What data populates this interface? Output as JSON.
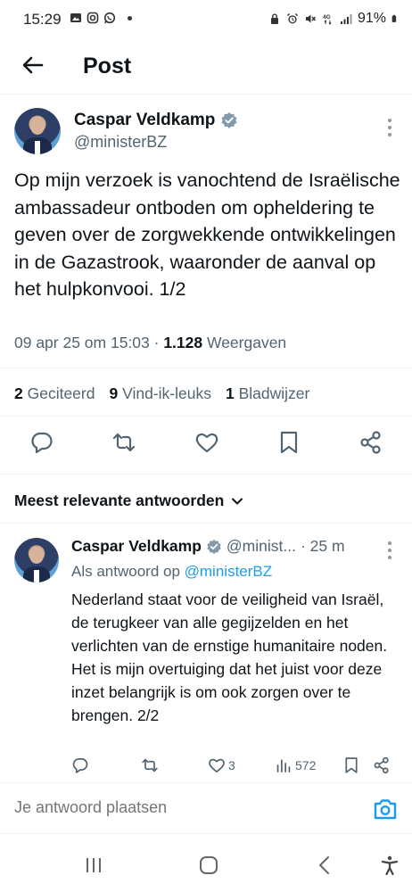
{
  "status_bar": {
    "time": "15:29",
    "battery": "91%",
    "left_icons": [
      "gallery-icon",
      "instagram-icon",
      "whatsapp-icon",
      "dot"
    ],
    "right_icons": [
      "lock-icon",
      "alarm-icon",
      "mute-icon",
      "4g-icon",
      "signal-icon",
      "battery-icon"
    ]
  },
  "header": {
    "title": "Post"
  },
  "post": {
    "author_name": "Caspar Veldkamp",
    "author_handle": "@ministerBZ",
    "text": "Op mijn verzoek is vanochtend de Israëlische ambassadeur ontboden om opheldering te geven over de zorgwekkende ontwikkelingen in de Gazastrook, waaronder de aanval op het hulpkonvooi. 1/2",
    "date": "09 apr 25 om 15:03 · ",
    "views_count": "1.128",
    "views_label": " Weergaven"
  },
  "stats": {
    "reposts_count": "2",
    "reposts_label": "Geciteerd",
    "likes_count": "9",
    "likes_label": "Vind-ik-leuks",
    "bookmarks_count": "1",
    "bookmarks_label": "Bladwijzer"
  },
  "replies_section": {
    "title": "Meest relevante antwoorden"
  },
  "reply": {
    "author_name": "Caspar Veldkamp",
    "author_handle": "@minist...",
    "time": "· 25 m",
    "reply_to_prefix": "Als antwoord op ",
    "reply_to_handle": "@ministerBZ",
    "text": "Nederland staat voor de veiligheid van Israël, de terugkeer van alle gegijzelden en het verlichten van de ernstige humanitaire noden. Het is mijn overtuiging dat het juist voor deze inzet belangrijk is om ook zorgen over te brengen. 2/2",
    "likes": "3",
    "views": "572"
  },
  "compose": {
    "placeholder": "Je antwoord plaatsen"
  },
  "colors": {
    "accent": "#1d9bf0",
    "text": "#0f1419",
    "muted": "#536471",
    "divider": "#eff3f4"
  }
}
